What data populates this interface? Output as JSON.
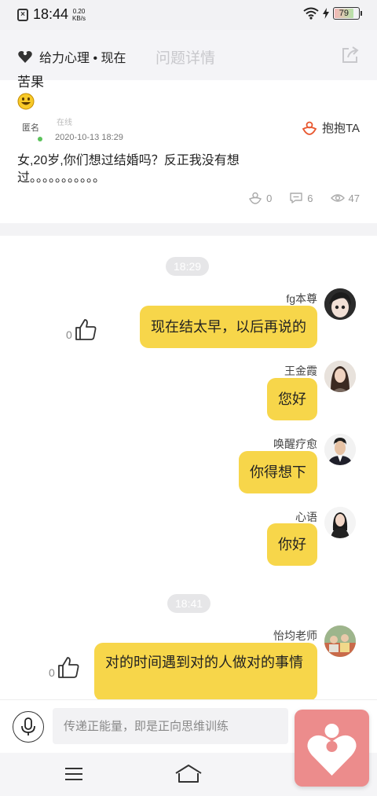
{
  "status_bar": {
    "time": "18:44",
    "net_speed_value": "0.20",
    "net_speed_unit": "KB/s",
    "battery": "79",
    "battery_level": 0.79
  },
  "header": {
    "source": "给力心理 • 现在",
    "title": "问题详情"
  },
  "question": {
    "title": "苦果",
    "author": "匿名",
    "online_label": "在线",
    "date": "2020-10-13 18:29",
    "hug_label": "抱抱TA",
    "body": "女,20岁,你们想过结婚吗？反正我没有想过。。。。。。。。。。。",
    "stats": {
      "hugs": "0",
      "comments": "6",
      "views": "47"
    }
  },
  "chat": {
    "time_1": "18:29",
    "time_2": "18:41",
    "messages": [
      {
        "user": "fg本尊",
        "text": "现在结太早，以后再说的",
        "likes": "0"
      },
      {
        "user": "王金霞",
        "text": "您好"
      },
      {
        "user": "唤醒疗愈",
        "text": "你得想下"
      },
      {
        "user": "心语",
        "text": "你好"
      },
      {
        "user": "怡均老师",
        "text": "对的时间遇到对的人做对的事情",
        "likes": "0"
      }
    ]
  },
  "input": {
    "placeholder": "传递正能量，即是正向思维训练"
  },
  "colors": {
    "bubble": "#f7d64a",
    "accent": "#e8572f",
    "float_widget": "#ec8c8c"
  }
}
